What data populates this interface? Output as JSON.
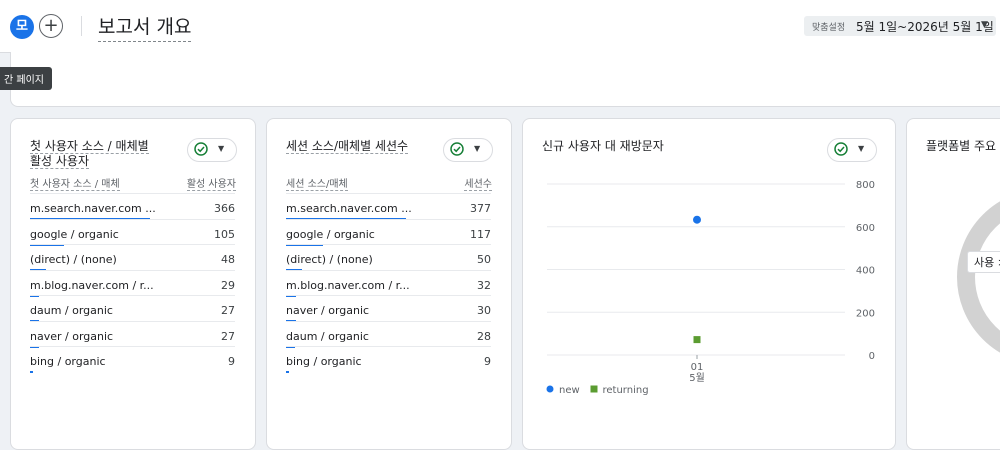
{
  "header": {
    "avatar_letter": "모",
    "add_symbol": "+",
    "title": "보고서 개요",
    "date_prefix": "맞춤설정",
    "date_range": "5월 1일~2026년 5월 1일"
  },
  "tooltip": "간 페이지",
  "cards": [
    {
      "title_line1": "첫 사용자 소스 / 매체별",
      "title_line2": "활성 사용자",
      "col_dim": "첫 사용자 소스 / 매체",
      "col_metric": "활성 사용자",
      "rows": [
        {
          "label": "m.search.naver.com ...",
          "value": "366",
          "share": 1.0
        },
        {
          "label": "google / organic",
          "value": "105",
          "share": 0.287
        },
        {
          "label": "(direct) / (none)",
          "value": "48",
          "share": 0.131
        },
        {
          "label": "m.blog.naver.com / r...",
          "value": "29",
          "share": 0.079
        },
        {
          "label": "daum / organic",
          "value": "27",
          "share": 0.074
        },
        {
          "label": "naver / organic",
          "value": "27",
          "share": 0.074
        },
        {
          "label": "bing / organic",
          "value": "9",
          "share": 0.025
        }
      ]
    },
    {
      "title_line1": "세션 소스/매체별 세션수",
      "title_line2": "",
      "col_dim": "세션 소스/매체",
      "col_metric": "세션수",
      "rows": [
        {
          "label": "m.search.naver.com ...",
          "value": "377",
          "share": 1.0
        },
        {
          "label": "google / organic",
          "value": "117",
          "share": 0.31
        },
        {
          "label": "(direct) / (none)",
          "value": "50",
          "share": 0.133
        },
        {
          "label": "m.blog.naver.com / r...",
          "value": "32",
          "share": 0.085
        },
        {
          "label": "naver / organic",
          "value": "30",
          "share": 0.08
        },
        {
          "label": "daum / organic",
          "value": "28",
          "share": 0.074
        },
        {
          "label": "bing / organic",
          "value": "9",
          "share": 0.024
        }
      ]
    }
  ],
  "line_card": {
    "title": "신규 사용자 대 재방문자"
  },
  "donut_card": {
    "title": "플랫폼별 주요 이",
    "center_label": "사용 >"
  },
  "chart_data": {
    "type": "scatter",
    "title": "신규 사용자 대 재방문자",
    "x": [
      "01"
    ],
    "x_tick_labels": [
      "01",
      "5월"
    ],
    "yticks": [
      0,
      200,
      400,
      600,
      800
    ],
    "ylim": [
      0,
      800
    ],
    "grid": true,
    "legend_position": "bottom-left",
    "series": [
      {
        "name": "new",
        "values": [
          633
        ],
        "color": "#1a73e8",
        "marker": "circle"
      },
      {
        "name": "returning",
        "values": [
          72
        ],
        "color": "#5b9c31",
        "marker": "square"
      }
    ]
  }
}
